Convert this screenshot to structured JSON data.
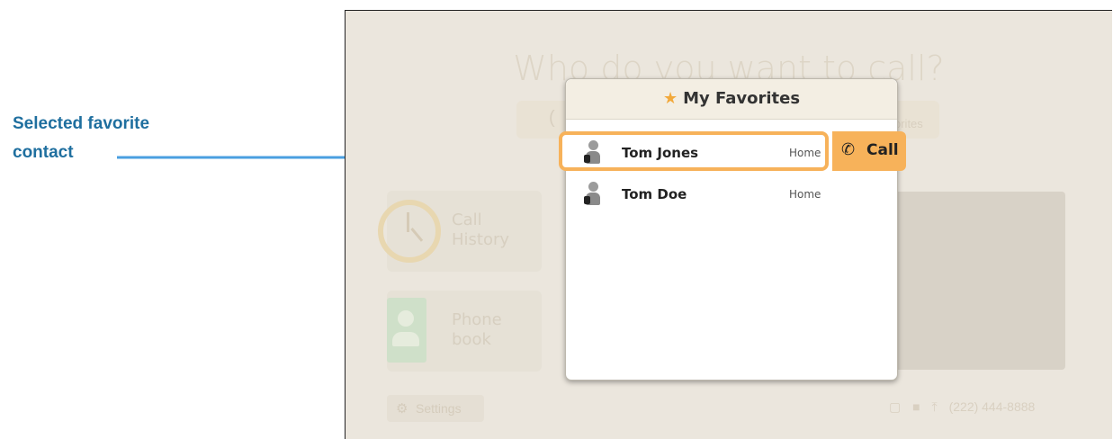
{
  "annotation": {
    "line1": "Selected favorite",
    "line2": "contact"
  },
  "background": {
    "prompt": "Who do you want to call?",
    "search_prefix": "(",
    "favorites_tab_fragment": "orites",
    "call_history_line1": "Call",
    "call_history_line2": "History",
    "phonebook_line1": "Phone",
    "phonebook_line2": "book",
    "settings_label": "Settings",
    "phone_number": "(222) 444-8888"
  },
  "dialog": {
    "title": "My Favorites",
    "contacts": [
      {
        "name": "Tom Jones",
        "type": "Home",
        "selected": true
      },
      {
        "name": "Tom Doe",
        "type": "Home",
        "selected": false
      }
    ],
    "call_label": "Call"
  },
  "colors": {
    "accent": "#f7b25a",
    "annotation": "#1f6f9f",
    "arrow": "#4a9fe0",
    "star": "#f2a93b"
  }
}
